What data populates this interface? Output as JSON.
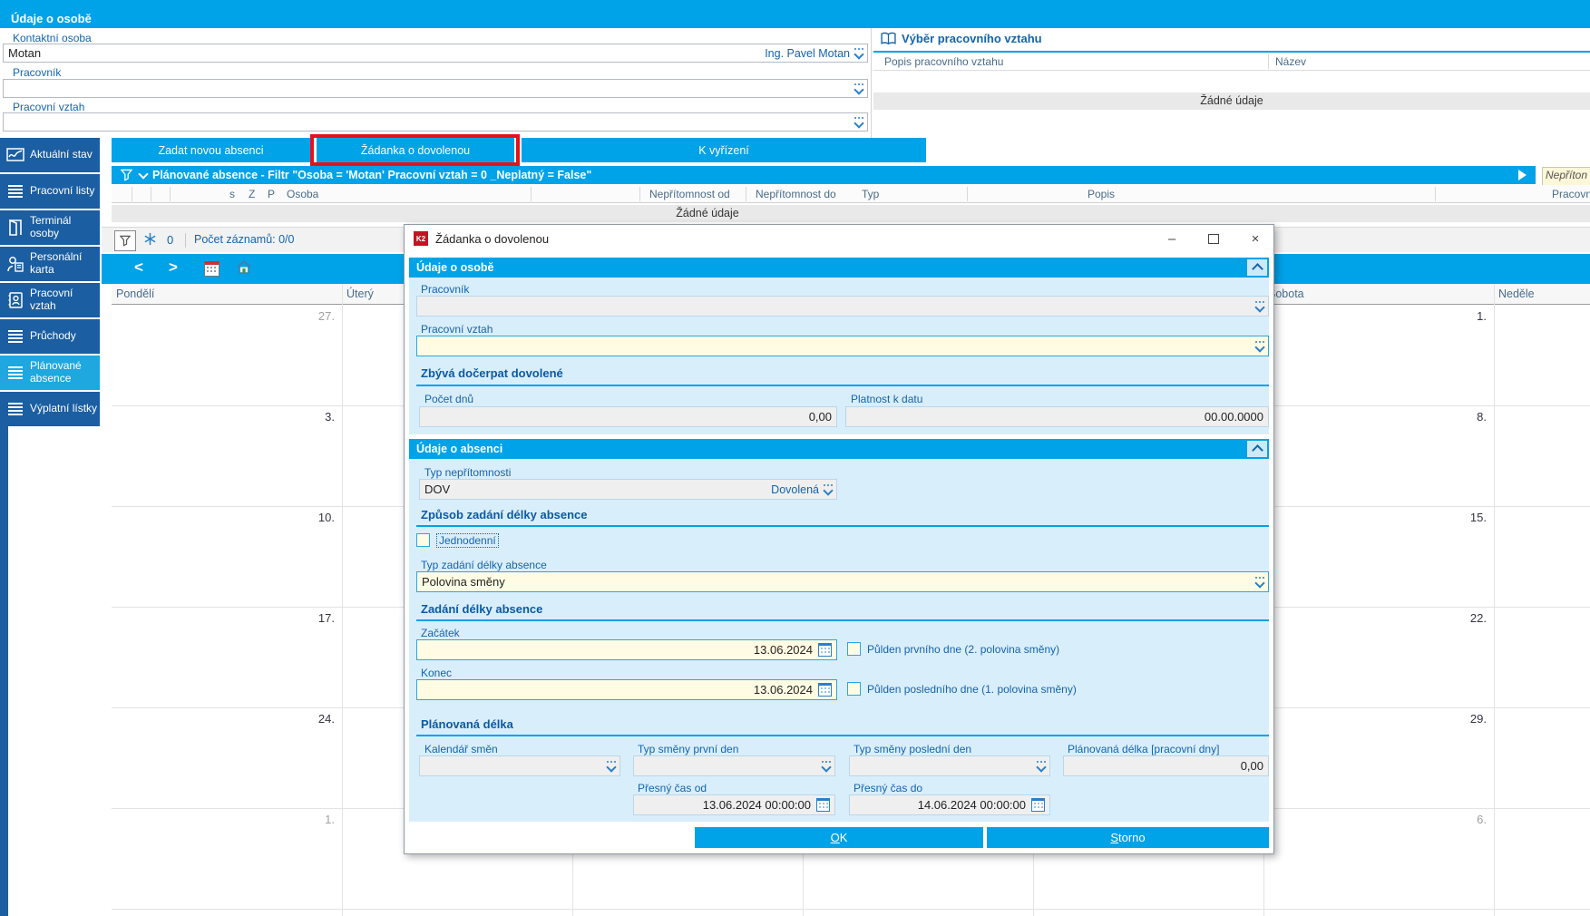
{
  "colors": {
    "accent": "#00a2e8",
    "sidebar": "#1b5ea2",
    "sidebar_active": "#1fa7e0",
    "highlight_red": "#e3131b",
    "field_required_bg": "#fffce3",
    "field_readonly_bg": "#efefef",
    "label_blue": "#1464ac"
  },
  "app": {
    "header_title": "Údaje o osobě"
  },
  "person_form": {
    "contact_label": "Kontaktní osoba",
    "contact_value": "Motan",
    "contact_selected": "Ing. Pavel Motan",
    "worker_label": "Pracovník",
    "relation_label": "Pracovní vztah"
  },
  "relation_panel": {
    "title": "Výběr pracovního vztahu",
    "col_desc": "Popis pracovního vztahu",
    "col_name": "Název",
    "empty_text": "Žádné údaje"
  },
  "tabs": {
    "new_absence": "Zadat novou absenci",
    "vacation_request": "Žádanka o dovolenou",
    "to_process": "K vyřízení"
  },
  "filter_bar": {
    "text": "Plánované absence - Filtr \"Osoba = 'Motan'  Pracovní vztah = 0 _Neplatný = False\"",
    "side_note": "Nepříton"
  },
  "absence_table": {
    "col_s": "s",
    "col_z": "Z",
    "col_p": "P",
    "col_osoba": "Osoba",
    "col_from": "Nepřítomnost od",
    "col_to": "Nepřítomnost do",
    "col_typ": "Typ",
    "col_popis": "Popis",
    "col_vztah": "Pracovní vztah",
    "empty_text": "Žádné údaje"
  },
  "status_bar": {
    "filter_count": "0",
    "records": "Počet záznamů: 0/0"
  },
  "sidebar": {
    "items": [
      {
        "label": "Aktuální stav",
        "icon": "chart"
      },
      {
        "label": "Pracovní listy",
        "icon": "lines"
      },
      {
        "label": "Terminál osoby",
        "icon": "door"
      },
      {
        "label": "Personální karta",
        "icon": "person-card"
      },
      {
        "label": "Pracovní vztah",
        "icon": "book-person"
      },
      {
        "label": "Průchody",
        "icon": "lines"
      },
      {
        "label": "Plánované absence",
        "icon": "lines",
        "active": true
      },
      {
        "label": "Výplatní lístky",
        "icon": "lines"
      }
    ]
  },
  "calendar": {
    "days": [
      "Pondělí",
      "Úterý",
      "",
      "",
      "",
      "Sobota",
      "Neděle"
    ],
    "monday": [
      {
        "t": "27."
      },
      {
        "t": "3."
      },
      {
        "t": "10."
      },
      {
        "t": "17."
      },
      {
        "t": "24."
      },
      {
        "t": "1."
      }
    ],
    "saturday": [
      {
        "t": "1."
      },
      {
        "t": "8."
      },
      {
        "t": "15."
      },
      {
        "t": "22."
      },
      {
        "t": "29."
      },
      {
        "t": "6."
      }
    ]
  },
  "dialog": {
    "title": "Žádanka o dovolenou",
    "section_person": {
      "header": "Údaje o osobě",
      "worker_label": "Pracovník",
      "relation_label": "Pracovní vztah",
      "remaining_title": "Zbývá dočerpat dovolené",
      "days_label": "Počet dnů",
      "days_value": "0,00",
      "validity_label": "Platnost k datu",
      "validity_value": "00.00.0000"
    },
    "section_absence": {
      "header": "Údaje o absenci",
      "type_label": "Typ nepřítomnosti",
      "type_code": "DOV",
      "type_name": "Dovolená",
      "method_title": "Způsob zadání délky absence",
      "oneday_label": "Jednodenní",
      "entry_type_label": "Typ zadání délky absence",
      "entry_type_value": "Polovina směny",
      "length_title": "Zadání délky absence",
      "start_label": "Začátek",
      "start_value": "13.06.2024",
      "halfday_first_label": "Půlden prvního dne (2. polovina směny)",
      "end_label": "Konec",
      "end_value": "13.06.2024",
      "halfday_last_label": "Půlden posledního dne  (1. polovina směny)",
      "planned_title": "Plánovaná délka",
      "shift_calendar_label": "Kalendář směn",
      "shift_first_label": "Typ směny první den",
      "shift_last_label": "Typ směny poslední den",
      "planned_length_label": "Plánovaná délka [pracovní dny]",
      "planned_length_value": "0,00",
      "exact_from_label": "Přesný čas od",
      "exact_from_value": "13.06.2024 00:00:00",
      "exact_to_label": "Přesný čas do",
      "exact_to_value": "14.06.2024 00:00:00"
    },
    "buttons": {
      "ok": "OK",
      "storno": "Storno"
    }
  }
}
